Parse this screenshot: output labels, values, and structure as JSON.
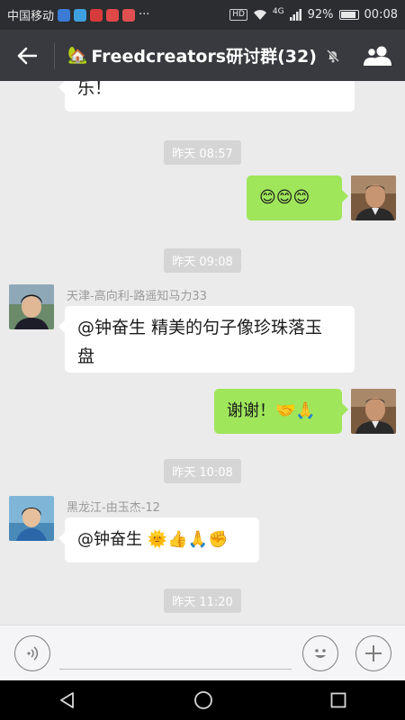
{
  "status_bar": {
    "carrier": "中国移动",
    "more": "···",
    "hd": "HD",
    "network": "4G",
    "battery_level": 0.92,
    "battery_text": "92%",
    "time": "00:08"
  },
  "header": {
    "title": "Freedcreators研讨群(32)",
    "title_icon": "house-emoji",
    "muted_icon": "bell-off-icon",
    "right_icon": "group-members-icon"
  },
  "messages": [
    {
      "type": "in",
      "text": "乐！"
    },
    {
      "type": "time",
      "text": "昨天 08:57"
    },
    {
      "type": "out",
      "text": "😊😊😊"
    },
    {
      "type": "time",
      "text": "昨天 09:08"
    },
    {
      "type": "in",
      "sender": "天津-高向利-路遥知马力33",
      "text_line1": "@钟奋生  精美的句子像珍珠落玉",
      "text_line2": "盘"
    },
    {
      "type": "out",
      "text": "谢谢！🤝🙏"
    },
    {
      "type": "time",
      "text": "昨天 10:08"
    },
    {
      "type": "in",
      "sender": "黑龙江-由玉杰-12",
      "text": "@钟奋生 🌞👍🙏✊"
    },
    {
      "type": "time",
      "text": "昨天 11:20"
    }
  ],
  "colors": {
    "header_bg": "#393a3f",
    "chat_bg": "#ebebeb",
    "outgoing_bubble": "#9fe65b",
    "incoming_bubble": "#ffffff"
  }
}
